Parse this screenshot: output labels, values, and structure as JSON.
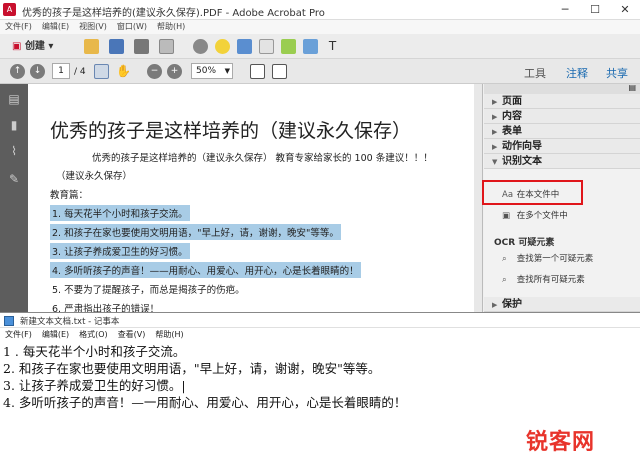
{
  "acrobat": {
    "title": "优秀的孩子是这样培养的(建议永久保存).PDF - Adobe Acrobat Pro",
    "app_icon": "acrobat-icon",
    "menu": [
      "文件(F)",
      "编辑(E)",
      "视图(V)",
      "窗口(W)",
      "帮助(H)"
    ],
    "create_label": "创建",
    "page_current": "1",
    "page_total": "/ 4",
    "zoom": "50%",
    "right_links": [
      "工具",
      "注释",
      "共享"
    ],
    "document": {
      "title": "优秀的孩子是这样培养的（建议永久保存）",
      "subtitle": "优秀的孩子是这样培养的（建议永久保存） 教育专家给家长的 100 条建议！！！",
      "subtitle2": "（建议永久保存）",
      "section": "教育篇：",
      "lines": [
        "1. 每天花半个小时和孩子交流。",
        "2. 和孩子在家也要使用文明用语，\"早上好，请，谢谢，晚安\"等等。",
        "3. 让孩子养成爱卫生的好习惯。",
        "4. 多听听孩子的声音！——用耐心、用爱心、用开心，心是长着眼睛的！",
        "5. 不要为了提醒孩子，而总是揭孩子的伤疤。",
        "6. 严肃指出孩子的错误！"
      ]
    },
    "panel": {
      "sections_top": [
        "页面",
        "内容",
        "表单",
        "动作向导",
        "识别文本"
      ],
      "items": [
        "在本文件中",
        "在多个文件中"
      ],
      "ocr_heading": "OCR 可疑元素",
      "ocr_items": [
        "查找第一个可疑元素",
        "查找所有可疑元素"
      ],
      "bottom_section": "保护"
    }
  },
  "notepad": {
    "title": "新建文本文档.txt - 记事本",
    "menu": [
      "文件(F)",
      "编辑(E)",
      "格式(O)",
      "查看(V)",
      "帮助(H)"
    ],
    "lines": [
      "1 .  每天花半个小时和孩子交流。",
      "2. 和孩子在家也要使用文明用语，\"早上好，请，谢谢，晚安\"等等。",
      "3. 让孩子养成爱卫生的好习惯。|",
      "4. 多听听孩子的声音！—一用耐心、用爱心、用开心，心是长着眼睛的！"
    ]
  },
  "watermark": "锐客网",
  "colors": {
    "highlight": "#a8cce6",
    "redbox": "#e0161b",
    "watermark": "#e8342b"
  }
}
